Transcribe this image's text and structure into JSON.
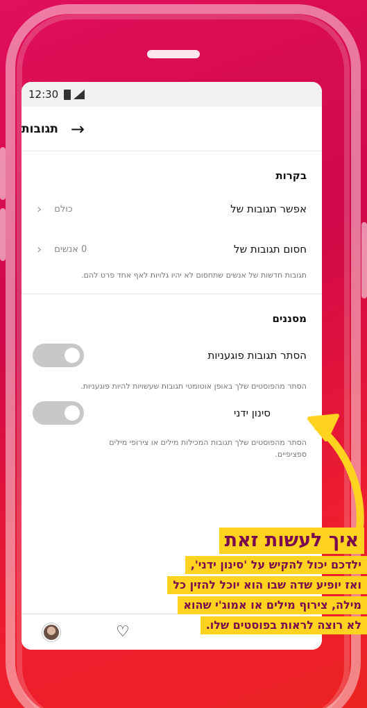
{
  "status_bar": {
    "time": "12:30"
  },
  "header": {
    "title": "תגובות"
  },
  "controls_section": {
    "title": "בקרות",
    "allow_comments": {
      "label": "אפשר תגובות של",
      "value": "כולם"
    },
    "block_comments": {
      "label": "חסום תגובות של",
      "value": "0 אנשים"
    },
    "block_description": "תגובות חדשות של אנשים שתחסום לא יהיו גלויות לאף אחד פרט להם."
  },
  "filters_section": {
    "title": "מסננים",
    "hide_offensive": {
      "label": "הסתר תגובות פוגעניות",
      "description": "הסתר מהפוסטים שלך באופן אוטומטי תגובות שעשויות להיות פוגעניות.",
      "enabled": false
    },
    "manual_filter": {
      "label": "סינון ידני",
      "description": "הסתר מהפוסטים שלך תגובות המכילות מילים או צירופי מילים ספציפיים.",
      "enabled": false
    }
  },
  "annotation": {
    "title": "איך לעשות זאת",
    "lines": [
      "ילדכם יכול להקיש על 'סינון ידני',",
      "ואז יופיע שדה שבו הוא יוכל להזין כל",
      "מילה, צירוף מילים או אמוג'י שהוא",
      "לא רוצה לראות בפוסטים שלו."
    ]
  },
  "colors": {
    "accent": "#ffd320",
    "callout_text": "#7a0a4e",
    "background": "#e0105a"
  },
  "icons": {
    "back": "arrow-right-icon",
    "chevron": "chevron-left-icon",
    "heart": "heart-icon"
  }
}
